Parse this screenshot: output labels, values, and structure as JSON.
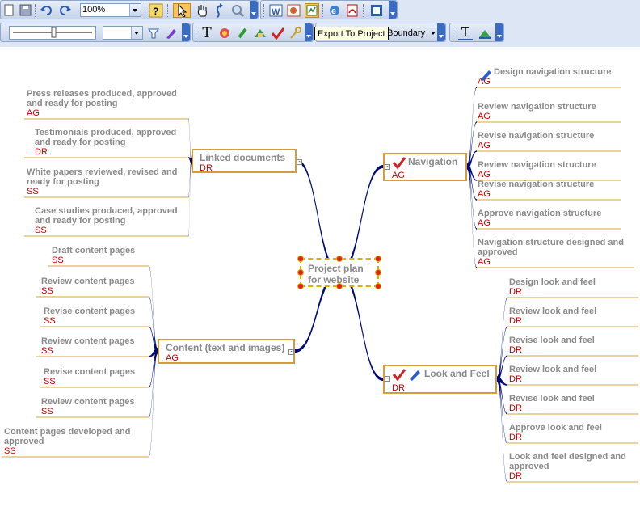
{
  "toolbar": {
    "zoom_value": "100%",
    "tooltip": "Export To Project",
    "boundary_label": "Boundary",
    "text_tool_glyph": "T"
  },
  "map": {
    "central": {
      "label_line1": "Project plan",
      "label_line2": "for website"
    },
    "linked_documents": {
      "label": "Linked documents",
      "resource": "DR",
      "subtopics": [
        {
          "line1": "Press releases produced, approved",
          "line2": "and ready for posting",
          "resource": "AG"
        },
        {
          "line1": "Testimonials produced, approved",
          "line2": "and ready for posting",
          "resource": "DR"
        },
        {
          "line1": "White papers reviewed, revised and",
          "line2": "ready for posting",
          "resource": "SS"
        },
        {
          "line1": "Case studies produced, approved",
          "line2": "and ready for posting",
          "resource": "SS"
        }
      ]
    },
    "content": {
      "label": "Content (text and images)",
      "resource": "AG",
      "subtopics": [
        {
          "line1": "Draft content pages",
          "resource": "SS"
        },
        {
          "line1": "Review content pages",
          "resource": "SS"
        },
        {
          "line1": "Revise content pages",
          "resource": "SS"
        },
        {
          "line1": "Review content pages",
          "resource": "SS"
        },
        {
          "line1": "Revise content pages",
          "resource": "SS"
        },
        {
          "line1": "Review content pages",
          "resource": "SS"
        },
        {
          "line1": "Content pages developed and",
          "line2": "approved",
          "resource": "SS"
        }
      ]
    },
    "navigation": {
      "label": "Navigation",
      "resource": "AG",
      "subtopics": [
        {
          "line1": "Design navigation structure",
          "resource": "AG"
        },
        {
          "line1": "Review navigation structure",
          "resource": "AG"
        },
        {
          "line1": "Revise navigation structure",
          "resource": "AG"
        },
        {
          "line1": "Review navigation structure",
          "resource": "AG"
        },
        {
          "line1": "Revise navigation structure",
          "resource": "AG"
        },
        {
          "line1": "Approve navigation structure",
          "resource": "AG"
        },
        {
          "line1": "Navigation structure designed and",
          "line2": "approved",
          "resource": "AG"
        }
      ]
    },
    "look_and_feel": {
      "label": "Look and Feel",
      "resource": "DR",
      "subtopics": [
        {
          "line1": "Design look and feel",
          "resource": "DR"
        },
        {
          "line1": "Review look and feel",
          "resource": "DR"
        },
        {
          "line1": "Revise look and feel",
          "resource": "DR"
        },
        {
          "line1": "Review look and feel",
          "resource": "DR"
        },
        {
          "line1": "Revise look and feel",
          "resource": "DR"
        },
        {
          "line1": "Approve look and feel",
          "resource": "DR"
        },
        {
          "line1": "Look and feel designed and",
          "line2": "approved",
          "resource": "DR"
        }
      ]
    }
  },
  "colors": {
    "branch": "#000a7a",
    "topic_border": "#d99a3a",
    "resource_text": "#cc0000",
    "label_text": "#8a8a8a",
    "underline": "#e8c47a"
  },
  "icons": [
    "new-icon",
    "save-icon",
    "undo-icon",
    "redo-icon",
    "help-icon",
    "pointer-icon",
    "hand-icon",
    "rotate-icon",
    "zoom-icon",
    "word-export-icon",
    "powerpoint-export-icon",
    "project-export-icon",
    "web-export-icon",
    "pdf-export-icon",
    "outlook-icon",
    "text-tool-icon",
    "check-icon",
    "pencil-icon",
    "key-icon"
  ]
}
